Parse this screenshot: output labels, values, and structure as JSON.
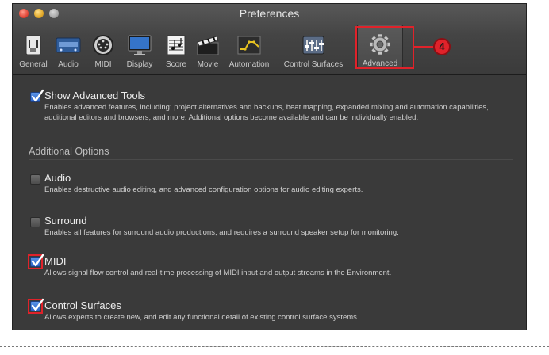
{
  "window": {
    "title": "Preferences"
  },
  "toolbar": {
    "items": [
      {
        "label": "General",
        "icon": "general-icon"
      },
      {
        "label": "Audio",
        "icon": "audio-icon"
      },
      {
        "label": "MIDI",
        "icon": "midi-icon"
      },
      {
        "label": "Display",
        "icon": "display-icon"
      },
      {
        "label": "Score",
        "icon": "score-icon"
      },
      {
        "label": "Movie",
        "icon": "movie-icon"
      },
      {
        "label": "Automation",
        "icon": "automation-icon"
      },
      {
        "label": "Control Surfaces",
        "icon": "control-surfaces-icon"
      },
      {
        "label": "Advanced",
        "icon": "gear-icon",
        "selected": true
      }
    ]
  },
  "callout": {
    "number": "4",
    "color": "#e0222a"
  },
  "advanced_tools": {
    "checked": true,
    "title": "Show Advanced Tools",
    "description": "Enables advanced features, including: project alternatives and backups, beat mapping, expanded mixing and automation capabilities, additional editors and browsers, and more. Additional options become available and can be individually enabled."
  },
  "additional": {
    "heading": "Additional Options",
    "options": [
      {
        "checked": false,
        "highlighted": false,
        "title": "Audio",
        "description": "Enables destructive audio editing, and advanced configuration options for audio editing experts."
      },
      {
        "checked": false,
        "highlighted": false,
        "title": "Surround",
        "description": "Enables all features for surround audio productions, and requires a surround speaker setup for monitoring."
      },
      {
        "checked": true,
        "highlighted": true,
        "title": "MIDI",
        "description": "Allows signal flow control and real-time processing of MIDI input and output streams in the Environment."
      },
      {
        "checked": true,
        "highlighted": true,
        "title": "Control Surfaces",
        "description": "Allows experts to create new, and edit any functional detail of existing control surface systems."
      }
    ]
  },
  "colors": {
    "accent": "#2a63c5",
    "window_bg": "#3a3a3a",
    "highlight": "#e0222a"
  }
}
